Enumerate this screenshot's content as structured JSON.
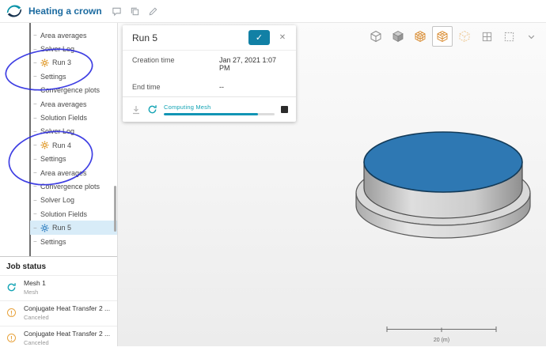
{
  "topbar": {
    "title": "Heating a crown"
  },
  "icons": {
    "dash": "−",
    "check": "✓",
    "close": "✕"
  },
  "tree": {
    "items": [
      {
        "label": "Area averages"
      },
      {
        "label": "Solver Log"
      },
      {
        "label": "Run 3"
      },
      {
        "label": "Settings"
      },
      {
        "label": "Convergence plots"
      },
      {
        "label": "Area averages"
      },
      {
        "label": "Solution Fields"
      },
      {
        "label": "Solver Log"
      },
      {
        "label": "Run 4"
      },
      {
        "label": "Settings"
      },
      {
        "label": "Area averages"
      },
      {
        "label": "Convergence plots"
      },
      {
        "label": "Solver Log"
      },
      {
        "label": "Solution Fields"
      },
      {
        "label": "Run 5"
      },
      {
        "label": "Settings"
      }
    ]
  },
  "job_status": {
    "title": "Job status",
    "jobs": [
      {
        "name": "Mesh 1",
        "status": "Mesh",
        "icon": "sync-icon"
      },
      {
        "name": "Conjugate Heat Transfer 2 ...",
        "status": "Canceled",
        "icon": "warning-icon"
      },
      {
        "name": "Conjugate Heat Transfer 2 ...",
        "status": "Canceled",
        "icon": "warning-icon"
      }
    ]
  },
  "run_panel": {
    "title": "Run 5",
    "rows": [
      {
        "label": "Creation time",
        "value": "Jan 27, 2021 1:07 PM"
      },
      {
        "label": "End time",
        "value": "--"
      }
    ],
    "progress": {
      "label": "Computing Mesh",
      "percent": 85
    }
  },
  "viewport": {
    "scale_label": "20 (m)",
    "toolbar_icons": [
      "cube-wire",
      "cube-shaded",
      "mesh-cube",
      "mesh-cube-active",
      "mesh-cube-faded",
      "grid",
      "select-region",
      "chevron-down"
    ]
  },
  "colors": {
    "accent_teal": "#12a3b4",
    "title_blue": "#1c6ba0",
    "gear_orange": "#e09b2d",
    "gear_blue": "#3b86c4",
    "selection_bg": "#d8ecf8",
    "disc_blue": "#2e78b3",
    "pen_blue": "#2a2ae0",
    "warning_orange": "#e8a33d"
  }
}
